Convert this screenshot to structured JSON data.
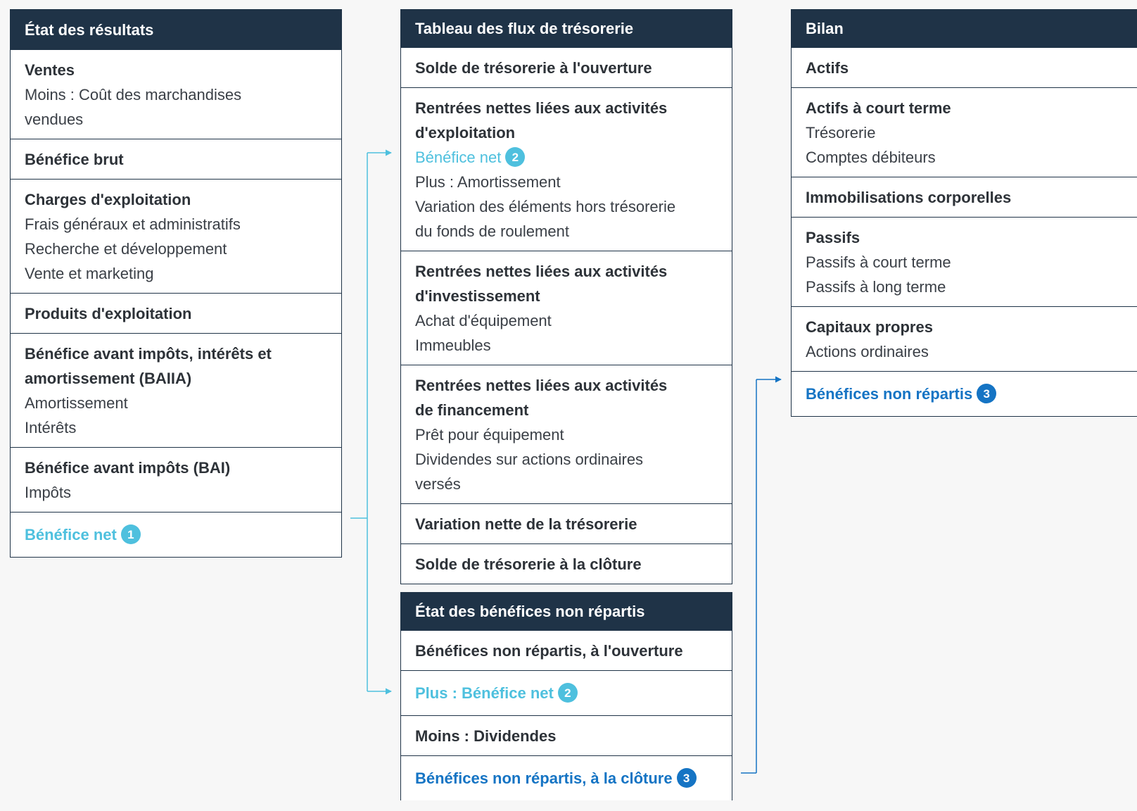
{
  "income": {
    "title": "État des résultats",
    "sections": [
      {
        "lines": [
          {
            "t": "Ventes",
            "s": "bold"
          },
          {
            "t": "Moins : Coût des marchandises",
            "s": "reg"
          },
          {
            "t": "vendues",
            "s": "reg"
          }
        ]
      },
      {
        "lines": [
          {
            "t": "Bénéfice brut",
            "s": "bold"
          }
        ]
      },
      {
        "lines": [
          {
            "t": "Charges d'exploitation",
            "s": "bold"
          },
          {
            "t": "Frais généraux et administratifs",
            "s": "reg"
          },
          {
            "t": "Recherche et développement",
            "s": "reg"
          },
          {
            "t": "Vente et marketing",
            "s": "reg"
          }
        ]
      },
      {
        "lines": [
          {
            "t": "Produits d'exploitation",
            "s": "bold"
          }
        ]
      },
      {
        "lines": [
          {
            "t": "Bénéfice avant impôts, intérêts et",
            "s": "bold"
          },
          {
            "t": "amortissement (BAIIA)",
            "s": "bold"
          },
          {
            "t": "Amortissement",
            "s": "reg"
          },
          {
            "t": "Intérêts",
            "s": "reg"
          }
        ]
      },
      {
        "lines": [
          {
            "t": "Bénéfice avant impôts (BAI)",
            "s": "bold"
          },
          {
            "t": "Impôts",
            "s": "reg"
          }
        ]
      },
      {
        "lines": [
          {
            "t": "Bénéfice net",
            "s": "bold light",
            "badge": "1",
            "bc": "light"
          }
        ]
      }
    ]
  },
  "cashflow": {
    "title": "Tableau des flux de trésorerie",
    "sections": [
      {
        "lines": [
          {
            "t": "Solde de trésorerie à l'ouverture",
            "s": "bold"
          }
        ]
      },
      {
        "lines": [
          {
            "t": "Rentrées nettes liées aux activités",
            "s": "bold"
          },
          {
            "t": "d'exploitation",
            "s": "bold"
          },
          {
            "t": "Bénéfice net",
            "s": "light",
            "badge": "2",
            "bc": "light"
          },
          {
            "t": "Plus : Amortissement",
            "s": "reg"
          },
          {
            "t": "Variation des éléments hors trésorerie",
            "s": "reg"
          },
          {
            "t": "du fonds de roulement",
            "s": "reg"
          }
        ]
      },
      {
        "lines": [
          {
            "t": "Rentrées nettes liées aux activités",
            "s": "bold"
          },
          {
            "t": "d'investissement",
            "s": "bold"
          },
          {
            "t": "Achat d'équipement",
            "s": "reg"
          },
          {
            "t": "Immeubles",
            "s": "reg"
          }
        ]
      },
      {
        "lines": [
          {
            "t": "Rentrées nettes liées aux activités",
            "s": "bold"
          },
          {
            "t": "de financement",
            "s": "bold"
          },
          {
            "t": "Prêt pour équipement",
            "s": "reg"
          },
          {
            "t": "Dividendes sur actions ordinaires",
            "s": "reg"
          },
          {
            "t": "versés",
            "s": "reg"
          }
        ]
      },
      {
        "lines": [
          {
            "t": "Variation nette de la trésorerie",
            "s": "bold"
          }
        ]
      },
      {
        "lines": [
          {
            "t": "Solde de trésorerie à la clôture",
            "s": "bold"
          }
        ]
      }
    ]
  },
  "retained": {
    "title": "État des bénéfices non répartis",
    "sections": [
      {
        "lines": [
          {
            "t": "Bénéfices non répartis, à l'ouverture",
            "s": "bold"
          }
        ]
      },
      {
        "lines": [
          {
            "t": "Plus : Bénéfice net",
            "s": "bold light",
            "badge": "2",
            "bc": "light"
          }
        ]
      },
      {
        "lines": [
          {
            "t": "Moins : Dividendes",
            "s": "bold"
          }
        ]
      },
      {
        "lines": [
          {
            "t": "Bénéfices non répartis, à la clôture",
            "s": "bold dark",
            "badge": "3",
            "bc": "dark"
          }
        ]
      }
    ]
  },
  "balance": {
    "title": "Bilan",
    "sections": [
      {
        "lines": [
          {
            "t": "Actifs",
            "s": "bold"
          }
        ]
      },
      {
        "lines": [
          {
            "t": "Actifs à court terme",
            "s": "bold"
          },
          {
            "t": "Trésorerie",
            "s": "reg"
          },
          {
            "t": "Comptes débiteurs",
            "s": "reg"
          }
        ]
      },
      {
        "lines": [
          {
            "t": "Immobilisations corporelles",
            "s": "bold"
          }
        ]
      },
      {
        "lines": [
          {
            "t": "Passifs",
            "s": "bold"
          },
          {
            "t": "Passifs à court terme",
            "s": "reg"
          },
          {
            "t": "Passifs à long terme",
            "s": "reg"
          }
        ]
      },
      {
        "lines": [
          {
            "t": "Capitaux propres",
            "s": "bold"
          },
          {
            "t": "Actions ordinaires",
            "s": "reg"
          }
        ]
      },
      {
        "lines": [
          {
            "t": "Bénéfices non répartis",
            "s": "bold dark",
            "badge": "3",
            "bc": "dark"
          }
        ]
      }
    ]
  },
  "colors": {
    "header": "#1f3347",
    "net_income_link": "#4ec0de",
    "retained_link": "#1574c4"
  }
}
